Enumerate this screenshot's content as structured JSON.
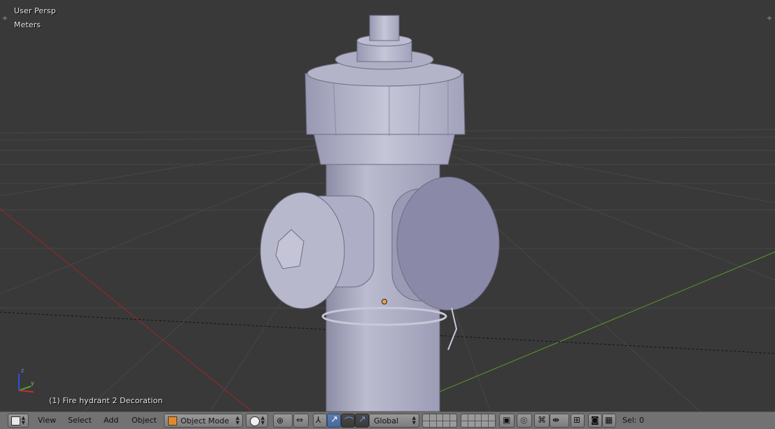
{
  "viewport": {
    "view_label": "User Persp",
    "units_label": "Meters",
    "object_info": "(1) Fire hydrant 2 Decoration",
    "axis_z": "z",
    "axis_y": "y",
    "axis_x": "x"
  },
  "header": {
    "menus": [
      "View",
      "Select",
      "Add",
      "Object"
    ],
    "mode": "Object Mode",
    "orientation": "Global",
    "selection_count": "Sel: 0"
  },
  "colors": {
    "viewport_bg": "#393939",
    "grid_line": "#474747",
    "x_axis": "#a02525",
    "y_axis": "#5a9b2a",
    "model": "#a8a8c0",
    "header_bg": "#727272",
    "active_blue": "#5c7fb2"
  },
  "icons": [
    "view3d-editor-icon",
    "solid-shading-icon",
    "pivot-icon",
    "manipulator-icon",
    "translate-icon",
    "rotate-icon",
    "scale-icon",
    "layers-grid",
    "lock-icon",
    "proportional-icon",
    "snap-icon",
    "snap-target-icon",
    "render-icon",
    "clapper-icon"
  ]
}
